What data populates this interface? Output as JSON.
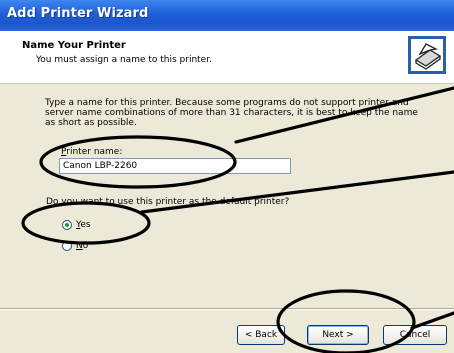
{
  "window": {
    "title": "Add Printer Wizard"
  },
  "header": {
    "title": "Name Your Printer",
    "subtitle": "You must assign a name to this printer.",
    "icon": "printer-icon"
  },
  "content": {
    "instructions": "Type a name for this printer. Because some programs do not support printer and server name combinations of more than 31 characters, it is best to keep the name as short as possible.",
    "printer_name_label_access": "P",
    "printer_name_label_rest": "rinter name:",
    "printer_name_value": "Canon LBP-2260",
    "default_question": "Do you want to use this printer as the default printer?",
    "yes_access": "Y",
    "yes_rest": "es",
    "no_access": "N",
    "no_rest": "o",
    "selected": "yes"
  },
  "buttons": {
    "back": "< Back",
    "next": "Next >",
    "cancel": "Cancel"
  },
  "colors": {
    "title_bar": "#1f5fd8",
    "annotation": "#000000"
  }
}
